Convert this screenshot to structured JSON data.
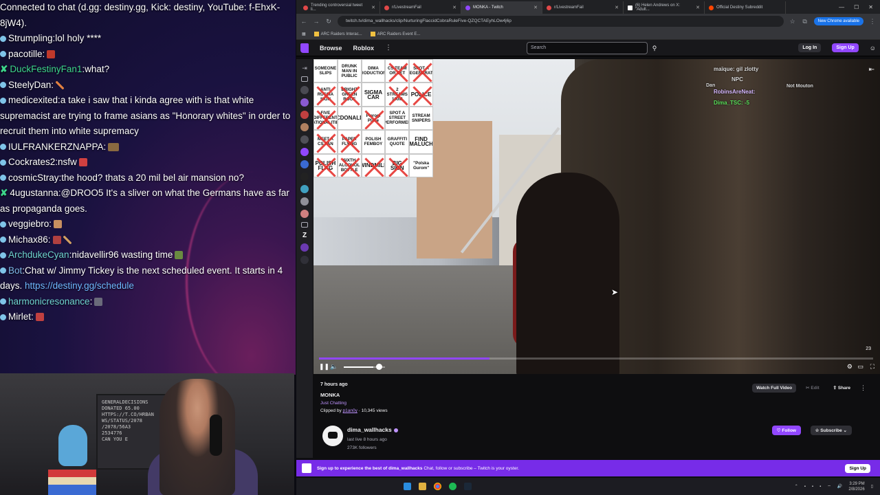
{
  "chat": {
    "lines": [
      {
        "user": "",
        "text": "Connected to chat (d.gg: destiny.gg, Kick: destiny, YouTube: f-EhxK-8jW4)."
      },
      {
        "user": "Strumpling",
        "text": "lol holy ****"
      },
      {
        "user": "pacotille",
        "text": ""
      },
      {
        "user": "DuckFestinyFan1",
        "text": "what?"
      },
      {
        "user": "SteelyDan",
        "text": ""
      },
      {
        "user": "medicexited",
        "text": "a take i saw that i kinda agree with is that white supremacist are trying to frame asians as \"Honorary whites\" in order to recruit them into white supremacy"
      },
      {
        "user": "IULFRANKERZNAPPA",
        "text": ""
      },
      {
        "user": "Cockrates2",
        "text": "nsfw"
      },
      {
        "user": "cosmicStray",
        "text": "the hood? thats a 20 mil bel air mansion no?"
      },
      {
        "user": "4ugustanna",
        "text": "@DROO5 It's a sliver on what the Germans have as far as propaganda goes."
      },
      {
        "user": "veggiebro",
        "text": ""
      },
      {
        "user": "Michax86",
        "text": ""
      },
      {
        "user": "ArchdukeCyan",
        "text": "nidavellir96 wasting time"
      },
      {
        "user": "Bot",
        "text": "Chat w/ Jimmy Tickey is the next scheduled event. It starts in 4 days.",
        "link": "https://destiny.gg/schedule"
      },
      {
        "user": "harmonicresonance",
        "text": ""
      },
      {
        "user": "Mirlet",
        "text": ""
      }
    ]
  },
  "webcam": {
    "board_text": "GENERALDECISIONS\nDONATED 65.00\nHTTPS://T.CO/HRBAN\nWS/STATUS/2078\n/2078/56A3\n2534776\nCAN YOU E"
  },
  "browser": {
    "tabs": [
      {
        "label": "Trending controversial tweet li..."
      },
      {
        "label": "r/LivestreamFail"
      },
      {
        "label": "MONKA - Twitch"
      },
      {
        "label": "r/LivestreamFail"
      },
      {
        "label": "(6) Helen Andrews on X: \"Adult..."
      },
      {
        "label": "Official Destiny Subreddit"
      }
    ],
    "url": "twitch.tv/dima_wallhacks/clip/NurturingFlaccidCobraRuleFive-QZQCTAEyhLOw4j6p",
    "chrome_update": "New Chrome available",
    "bookmarks": [
      "ARC Raiders Interac...",
      "ARC Raiders Event E..."
    ]
  },
  "twitch": {
    "nav": {
      "browse": "Browse",
      "category": "Roblox"
    },
    "search_placeholder": "Search",
    "login": "Log In",
    "signup": "Sign Up",
    "bingo": [
      "SOMEONE SLIPS",
      "DRUNK MAN IN PUBLIC",
      "DIMA PRODUCTIONS",
      "CS TEAM OR SET",
      "SPOT A DEGENERATE",
      "ANTI RUSSIA SIGN",
      "BRIGHT GREEN ROOF",
      "SIGMA CAR",
      "2 STREAMS 100M",
      "POLICE",
      "FIVE DIFFERENT NATIONALITIES",
      "MCDONALDS",
      "Pierogi Place",
      "SPOT A STREET PERFORMER",
      "STREAM SNIPERS",
      "MEET A CS FAN",
      "PAPER FLYING",
      "POLISH FEMBOY",
      "GRAFFITI QUOTE",
      "FIND MALUCH",
      "POLISH FLAG",
      "SIXTH ALCOHOL BOTTLE",
      "WINDMILL",
      "BIG SIGN",
      "\"Polska Gurom\""
    ],
    "bingo_crossed": [
      false,
      false,
      false,
      true,
      true,
      true,
      true,
      false,
      true,
      true,
      true,
      false,
      true,
      false,
      false,
      true,
      true,
      false,
      false,
      false,
      true,
      true,
      true,
      true,
      false
    ],
    "overlay": {
      "line1": "maïque: gil zlotty",
      "line2": "NPC",
      "line3": "RobinsAreNeat:",
      "line4": "Dima_TSC: -5",
      "left_label": "Dan",
      "right_label": "Not Mouton"
    },
    "video_time_badge": "23",
    "progress": 0.308,
    "volume": 0.72,
    "clip": {
      "ago": "7 hours ago",
      "title": "MONKA",
      "category": "Just Chatting",
      "clipped_by_prefix": "Clipped by",
      "clipped_by": "p1an0y",
      "views": "· 10,345 views"
    },
    "actions": {
      "watch_full": "Watch Full Video",
      "edit": "Edit",
      "share": "Share"
    },
    "channel": {
      "name": "dima_wallhacks",
      "last_live": "last live 8 hours ago",
      "followers": "273K followers",
      "follow": "Follow",
      "subscribe": "Subscribe"
    },
    "banner": {
      "lead": "Sign up to experience the best of dima_wallhacks",
      "rest": "Chat, follow or subscribe – Twitch is your oyster.",
      "button": "Sign Up"
    }
  },
  "taskbar": {
    "time": "3:29 PM",
    "date": "2/8/2026"
  },
  "colors": {
    "twitch_purple": "#9147ff",
    "banner_purple": "#772ce8",
    "link_blue": "#6fb8ff",
    "green_user": "#3dd68c"
  }
}
